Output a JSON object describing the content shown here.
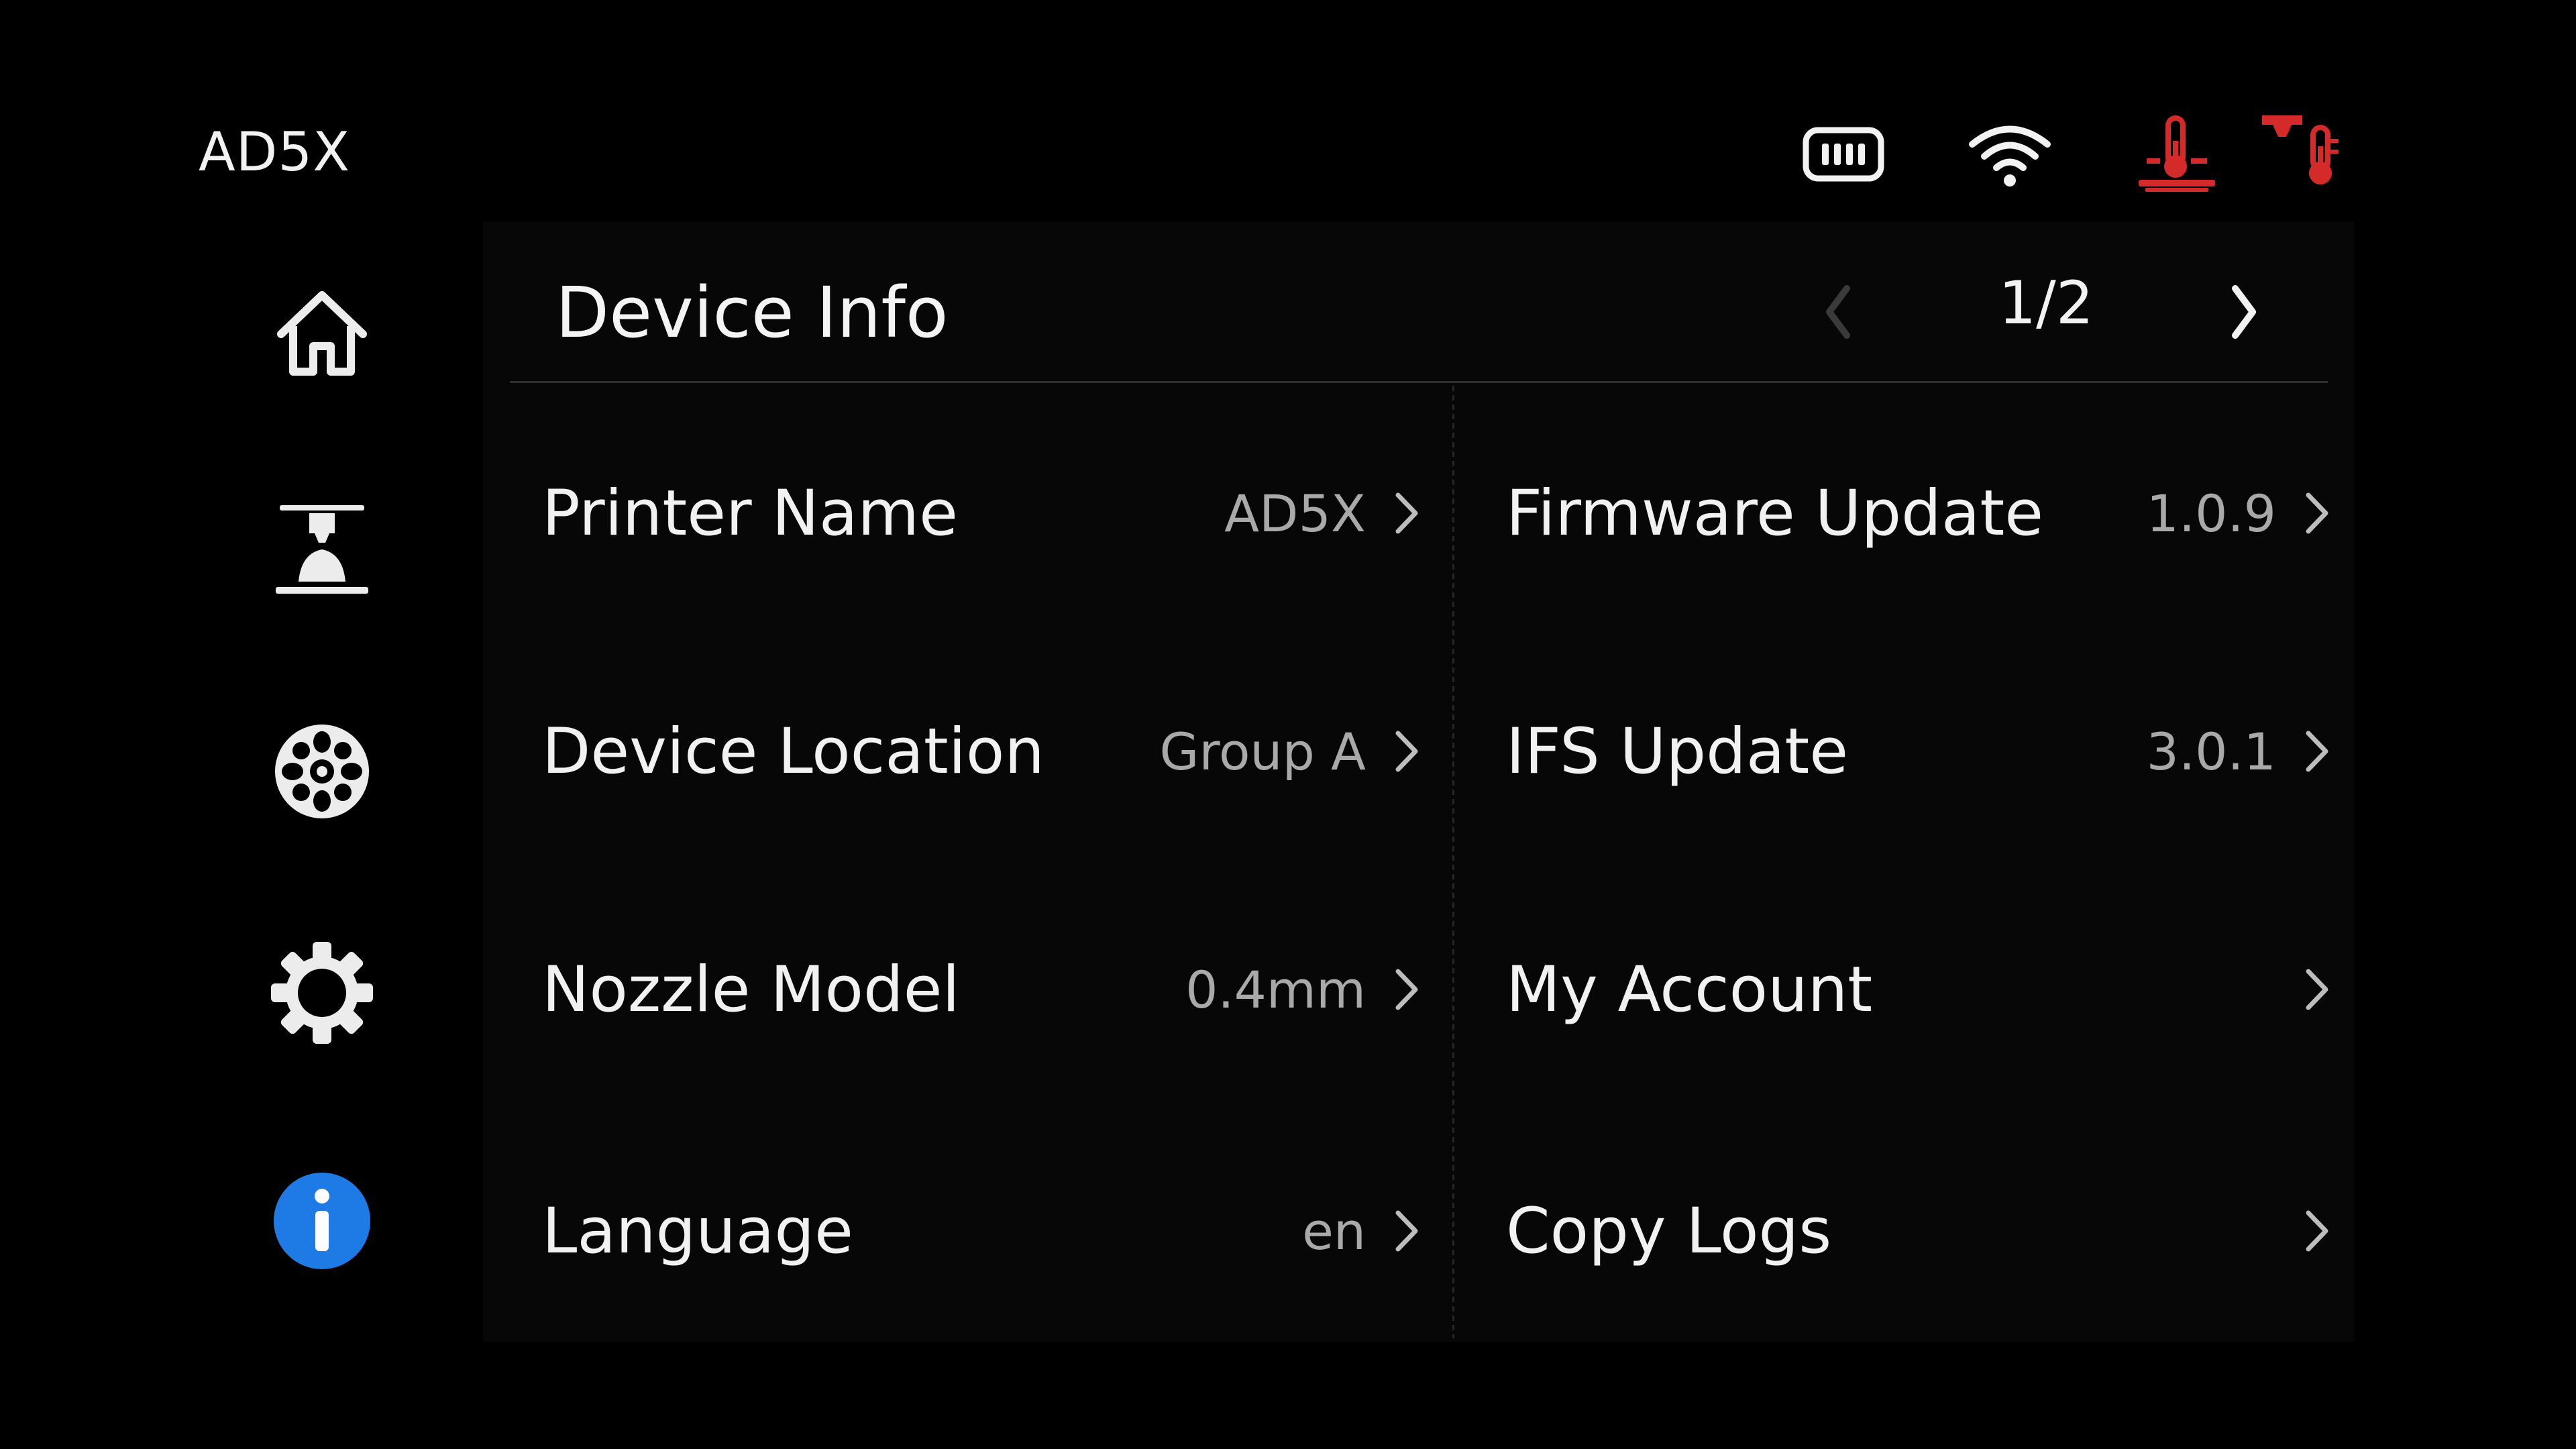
{
  "header": {
    "device_name": "AD5X",
    "status_icons": [
      {
        "name": "camera-icon"
      },
      {
        "name": "wifi-icon"
      },
      {
        "name": "bed-temperature-icon",
        "color": "#d42a2a"
      },
      {
        "name": "nozzle-temperature-icon",
        "color": "#d42a2a"
      }
    ]
  },
  "sidebar": {
    "items": [
      {
        "name": "home",
        "icon": "home-icon"
      },
      {
        "name": "print",
        "icon": "print-head-icon"
      },
      {
        "name": "filament",
        "icon": "filament-spool-icon"
      },
      {
        "name": "settings",
        "icon": "gear-icon"
      },
      {
        "name": "info",
        "icon": "info-icon",
        "active": true,
        "color": "#1e7be6"
      }
    ]
  },
  "panel": {
    "title": "Device Info",
    "pager": {
      "text": "1/2",
      "prev_enabled": false,
      "next_enabled": true
    },
    "left_rows": [
      {
        "label": "Printer Name",
        "value": "AD5X"
      },
      {
        "label": "Device Location",
        "value": "Group A"
      },
      {
        "label": "Nozzle Model",
        "value": "0.4mm"
      },
      {
        "label": "Language",
        "value": "en"
      }
    ],
    "right_rows": [
      {
        "label": "Firmware Update",
        "value": "1.0.9"
      },
      {
        "label": "IFS Update",
        "value": "3.0.1"
      },
      {
        "label": "My Account",
        "value": ""
      },
      {
        "label": "Copy Logs",
        "value": ""
      }
    ]
  },
  "colors": {
    "background": "#000000",
    "panel": "#070707",
    "text": "#f1f1f1",
    "secondary_text": "#a9a9a9",
    "accent": "#1e7be6",
    "alert": "#d42a2a"
  }
}
